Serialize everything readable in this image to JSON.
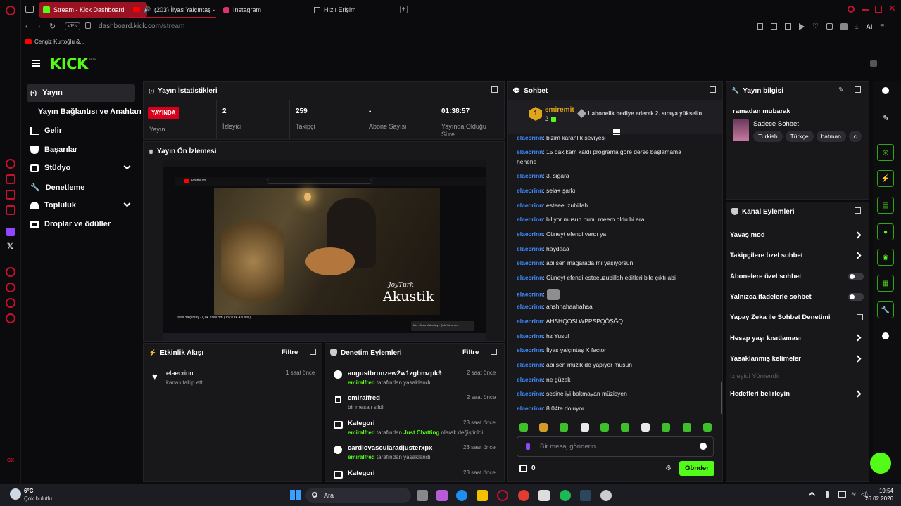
{
  "browser": {
    "tabs": [
      {
        "label": "Stream - Kick Dashboard"
      },
      {
        "label": "(203) İlyas Yalçıntaş -"
      },
      {
        "label": "Instagram"
      },
      {
        "label": "Hızlı Erişim"
      }
    ],
    "vpn": "VPN",
    "url_host": "dashboard.kick.com",
    "url_path": "/stream",
    "ai_label": "AI",
    "bookmark": "Cengiz Kurtoğlu &...",
    "rail_badge": "GX"
  },
  "kick": {
    "logo": "KICK",
    "logo_badge": "BETA"
  },
  "sidebar": {
    "items": [
      {
        "label": "Yayın",
        "icon": "broadcast-icon"
      },
      {
        "label": "Yayın Bağlantısı ve Anahtarı",
        "icon": ""
      },
      {
        "label": "Gelir",
        "icon": "chart-icon"
      },
      {
        "label": "Başarılar",
        "icon": "trophy-icon"
      },
      {
        "label": "Stüdyo",
        "icon": "studio-icon"
      },
      {
        "label": "Denetleme",
        "icon": "wrench-icon"
      },
      {
        "label": "Topluluk",
        "icon": "community-icon"
      },
      {
        "label": "Droplar ve ödüller",
        "icon": "drops-icon"
      }
    ]
  },
  "stats": {
    "title": "Yayın İstatistikleri",
    "live_badge": "YAYINDA",
    "live_label": "Yayın",
    "viewers_value": "2",
    "viewers_label": "İzleyici",
    "followers_value": "259",
    "followers_label": "Takipçi",
    "subs_value": "-",
    "subs_label": "Abone Sayısı",
    "uptime_value": "01:38:57",
    "uptime_label": "Yayında Olduğu Süre"
  },
  "preview": {
    "title": "Yayın Ön İzlemesi",
    "inner_tag": "JoyTurk",
    "inner_title": "Akustik",
    "inner_song": "İlyas Yalçıntaş - Çok Yalnızım (JoyTurk Akustik)",
    "inner_brand": "Premium",
    "inner_next": "Mix - İlyas Yalçıntaş - Çok Yalnızım..."
  },
  "activity": {
    "title": "Etkinlik Akışı",
    "filter": "Filtre",
    "items": [
      {
        "user": "elaecrinn",
        "text": "kanalı takip etti",
        "time": "1 saat önce"
      }
    ]
  },
  "moderation": {
    "title": "Denetim Eylemleri",
    "filter": "Filtre",
    "items": [
      {
        "title": "augustbronzew2w1zgbmzpk9",
        "actor": "emiralfred",
        "text": "tarafından yasaklandı",
        "time": "2 saat önce"
      },
      {
        "title": "emiralfred",
        "actor": "",
        "text": "bir mesajı sildi",
        "time": "2 saat önce"
      },
      {
        "title": "Kategori",
        "actor": "emiralfred",
        "text": "tarafından",
        "highlight": "Just Chatting",
        "text2": "olarak değiştirildi",
        "time": "23 saat önce"
      },
      {
        "title": "cardiovascularadjusterxpx",
        "actor": "emiralfred",
        "text": "tarafından yasaklandı",
        "time": "23 saat önce"
      },
      {
        "title": "Kategori",
        "actor": "",
        "text": "",
        "time": "23 saat önce"
      }
    ]
  },
  "chat": {
    "title": "Sohbet",
    "pinned_user": "emiremit",
    "pinned_count": "2",
    "pinned_rank": "1",
    "pinned_text": "1 abonelik hediye ederek 2. sıraya yükselin",
    "messages": [
      {
        "user": "elaecrinn",
        "text": ": bizim karanlık seviyesi"
      },
      {
        "user": "elaecrinn",
        "text": ": 15 dakikam kaldı programa göre derse başlamama"
      },
      {
        "user": "",
        "text": "hehehe"
      },
      {
        "user": "elaecrinn",
        "text": ": 3. sigara"
      },
      {
        "user": "elaecrinn",
        "text": ": sela+ şarkı"
      },
      {
        "user": "elaecrinn",
        "text": ": esteeeuzubillah"
      },
      {
        "user": "elaecrinn",
        "text": ": biliyor musun bunu meem oldu bi ara"
      },
      {
        "user": "elaecrinn",
        "text": ": Cüneyt efendi vardı ya"
      },
      {
        "user": "elaecrinn",
        "text": ": haydaaa"
      },
      {
        "user": "elaecrinn",
        "text": ": abi sen mağarada mı yaşıyorsun"
      },
      {
        "user": "elaecrinn",
        "text": ": Cüneyt efendi esteeuzubillah editleri bile çıktı abi"
      },
      {
        "user": "elaecrinn",
        "text": ":"
      },
      {
        "user": "elaecrinn",
        "text": ": ahshhahaahahaa"
      },
      {
        "user": "elaecrinn",
        "text": ": AHSHQOSLWPPSPQÖŞĞQ"
      },
      {
        "user": "elaecrinn",
        "text": ": hz Yusuf"
      },
      {
        "user": "elaecrinn",
        "text": ": İlyas yalçıntaş X factor"
      },
      {
        "user": "elaecrinn",
        "text": ": abi sen müzik de yapıyor musun"
      },
      {
        "user": "elaecrinn",
        "text": ": ne güzek"
      },
      {
        "user": "elaecrinn",
        "text": ": sesine iyi bakmayan müzisyen"
      },
      {
        "user": "elaecrinn",
        "text": ": 8.04te doluyor"
      }
    ],
    "input_placeholder": "Bir mesaj gönderin",
    "points": "0",
    "send": "Gönder"
  },
  "info": {
    "title": "Yayın bilgisi",
    "stream_title": "ramadan mubarak",
    "category": "Sadece Sohbet",
    "tags": [
      "Turkish",
      "Türkçe",
      "batman",
      "c"
    ]
  },
  "channel_actions": {
    "title": "Kanal Eylemleri",
    "items": [
      {
        "label": "Yavaş mod",
        "control": "chevron"
      },
      {
        "label": "Takipçilere özel sohbet",
        "control": "chevron"
      },
      {
        "label": "Abonelere özel sohbet",
        "control": "toggle"
      },
      {
        "label": "Yalnızca ifadelerle sohbet",
        "control": "toggle"
      },
      {
        "label": "Yapay Zeka ile Sohbet Denetimi",
        "control": "external"
      },
      {
        "label": "Hesap yaşı kısıtlaması",
        "control": "chevron"
      },
      {
        "label": "Yasaklanmış kelimeler",
        "control": "chevron"
      },
      {
        "label": "İzleyici Yönlendir",
        "control": "disabled"
      },
      {
        "label": "Hedefleri belirleyin",
        "control": "chevron"
      }
    ]
  },
  "taskbar": {
    "temp": "6°C",
    "weather": "Çok bulutlu",
    "search": "Ara",
    "time": "19:54",
    "date": "26.02.2026"
  },
  "colors": {
    "kick_green": "#53fc18",
    "live_red": "#d6001c",
    "username_blue": "#3f8cff",
    "opera_red": "#c8102e"
  }
}
